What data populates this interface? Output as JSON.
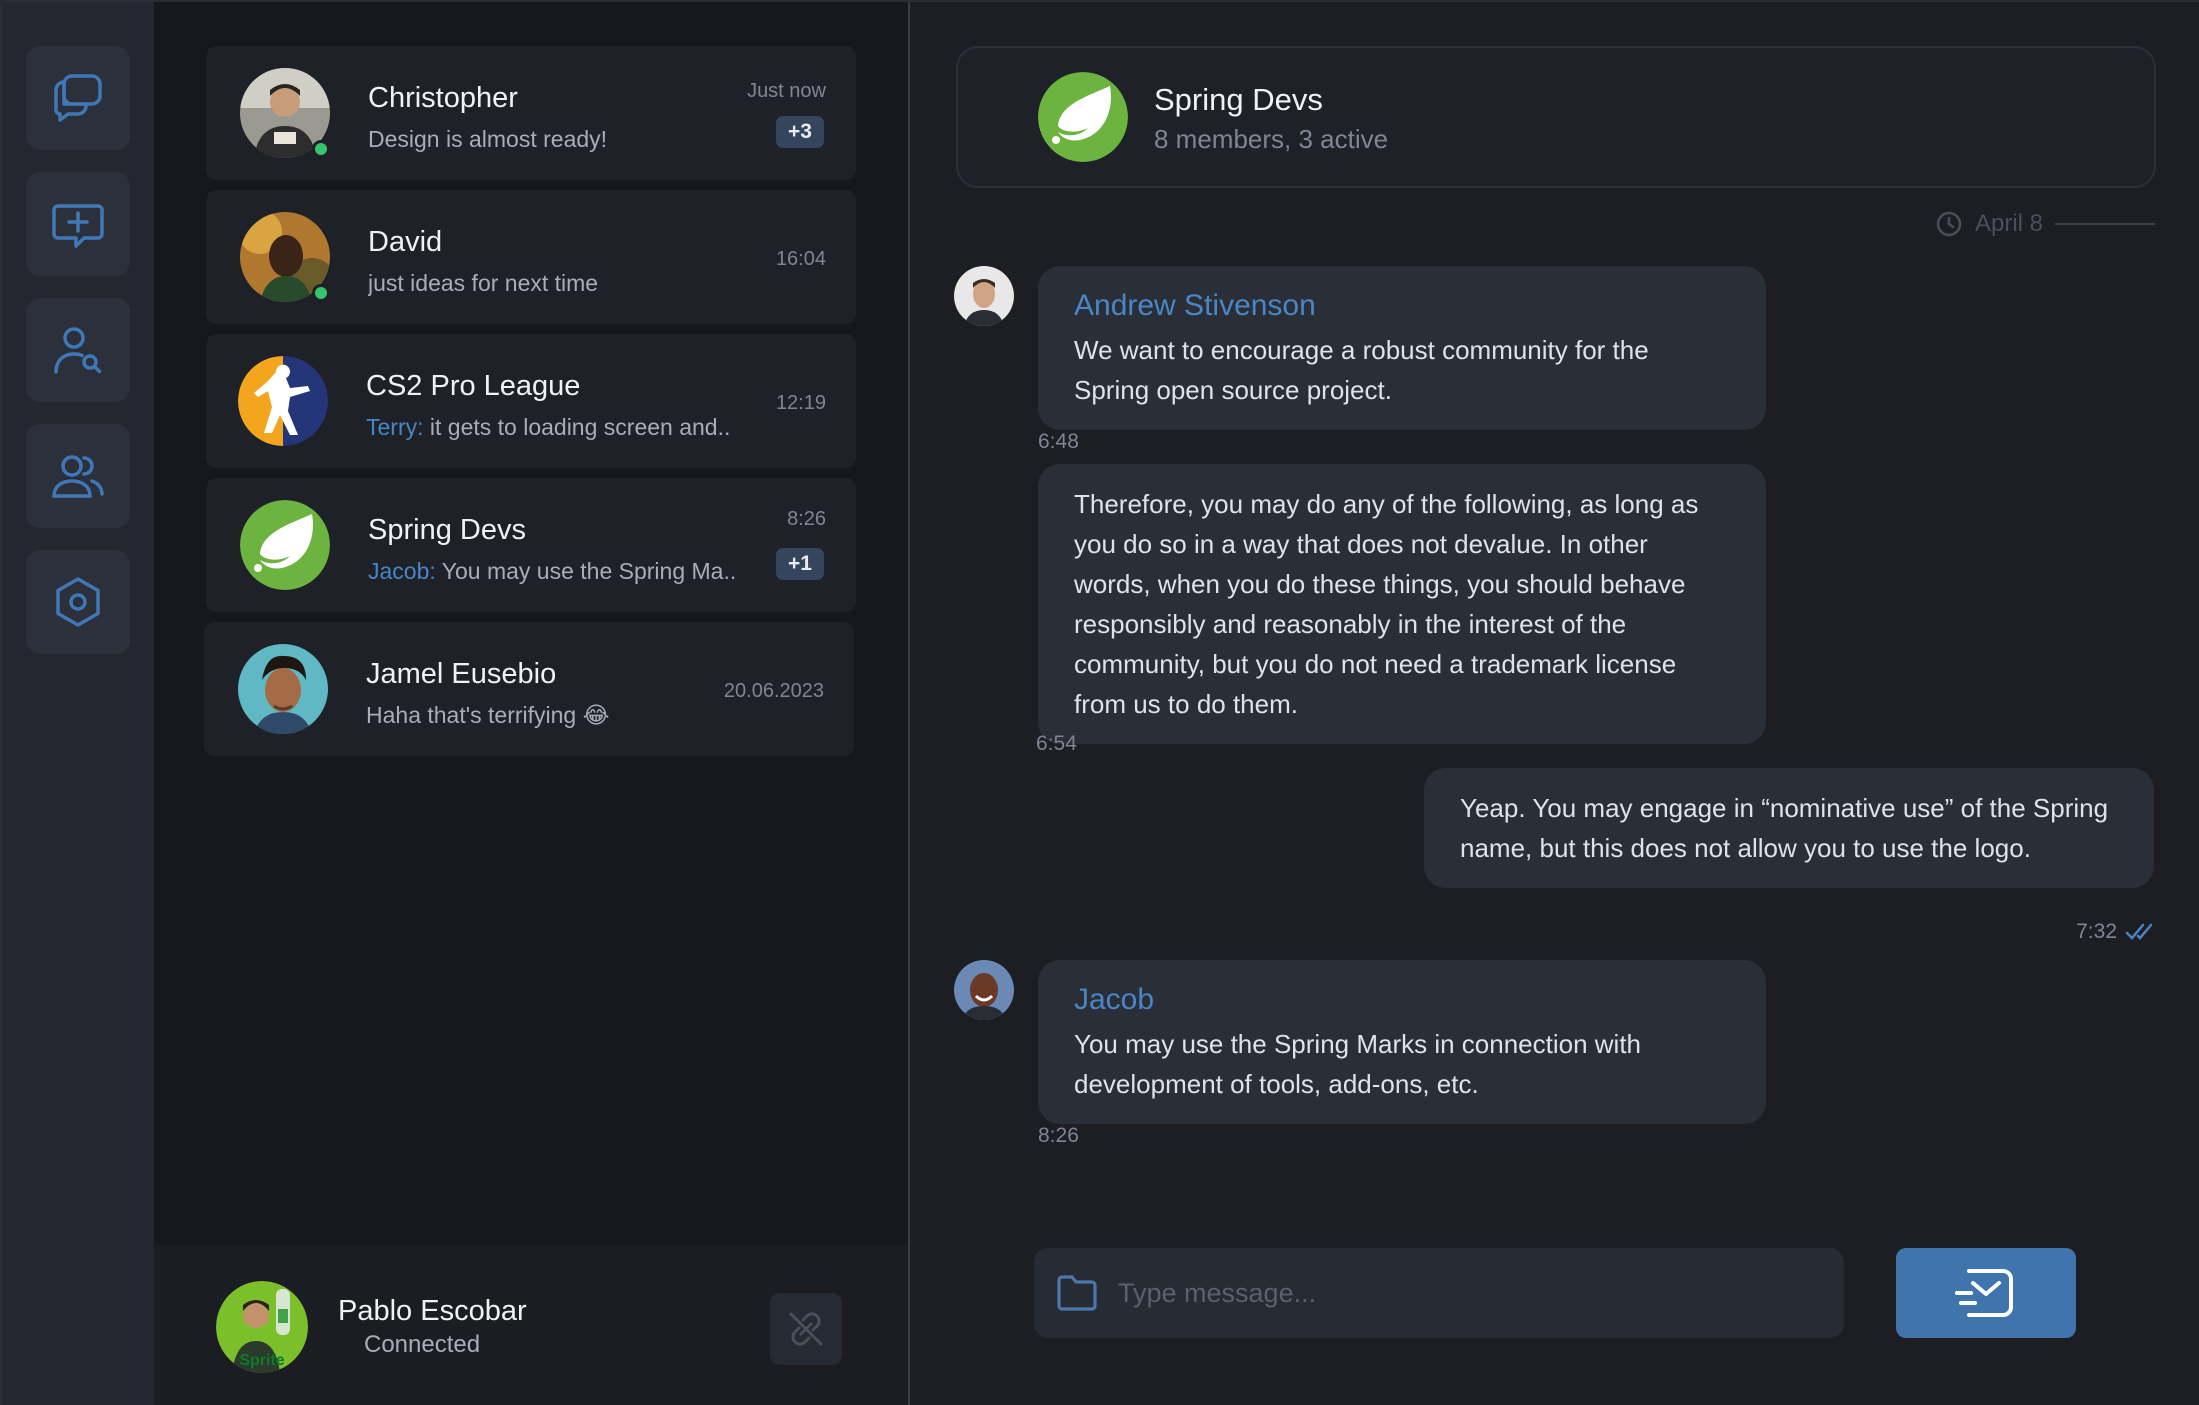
{
  "colors": {
    "accent": "#4a86c5",
    "background": "#1c1e24",
    "online": "#37c46b",
    "send_button": "#3f74ac"
  },
  "rail": {
    "items": [
      {
        "icon": "chats-icon"
      },
      {
        "icon": "new-chat-icon"
      },
      {
        "icon": "find-user-icon"
      },
      {
        "icon": "contacts-icon"
      },
      {
        "icon": "settings-icon"
      }
    ]
  },
  "chats": [
    {
      "name": "Christopher",
      "preview": "Design is almost ready!",
      "sender": "",
      "time": "Just now",
      "badge": "+3",
      "online": true
    },
    {
      "name": "David",
      "preview": "just ideas for next time",
      "sender": "",
      "time": "16:04",
      "badge": "",
      "online": true
    },
    {
      "name": "CS2 Pro League",
      "preview": " it gets to loading screen and..",
      "sender": "Terry:",
      "time": "12:19",
      "badge": "",
      "online": false
    },
    {
      "name": "Spring Devs",
      "preview": " You may use the Spring Ma..",
      "sender": "Jacob:",
      "time": "8:26",
      "badge": "+1",
      "online": false
    },
    {
      "name": "Jamel Eusebio",
      "preview": "Haha that's terrifying 😂",
      "sender": "",
      "time": "20.06.2023",
      "badge": "",
      "online": false
    }
  ],
  "profile": {
    "name": "Pablo Escobar",
    "status": "Connected",
    "avatar_text": "Sprite"
  },
  "conversation": {
    "title": "Spring Devs",
    "subtitle": "8 members, 3 active",
    "date": "April 8",
    "messages": [
      {
        "author": "Andrew Stivenson",
        "text": "We want to encourage a robust community for the Spring open source project.",
        "time": "6:48"
      },
      {
        "author": "",
        "text": "Therefore, you may do any of the following, as long as you do so in a way that does not devalue. In other words, when you do these things, you should behave responsibly and reasonably in the interest of the community, but you do not need a trademark license from us to do them.",
        "time": "6:54"
      },
      {
        "author": "",
        "text": "Yeap. You may engage in “nominative use” of the Spring name, but this does not allow you to use the logo.",
        "time": "7:32",
        "outgoing": true
      },
      {
        "author": "Jacob",
        "text": "You may use the Spring Marks in connection with development of tools, add-ons, etc.",
        "time": "8:26"
      }
    ]
  },
  "composer": {
    "placeholder": "Type message..."
  }
}
